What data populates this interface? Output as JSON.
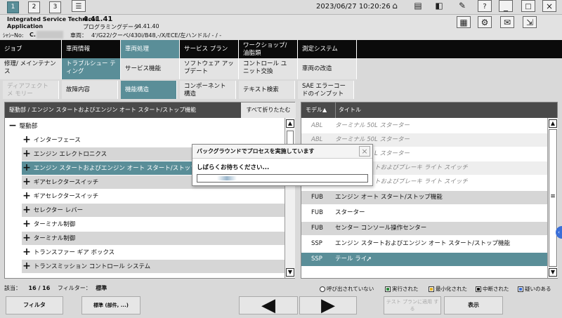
{
  "topbar": {
    "tabs": [
      "1",
      "2",
      "3"
    ],
    "datetime": "2023/06/27 10:20:26"
  },
  "info": {
    "app_line1": "Integrated Service Technical",
    "app_line2": "Application",
    "version": "4.41.41",
    "prog_label": "プログラミングデータ",
    "prog_version": "4.41.40",
    "vin_label": "ｼｬｼｰNo:",
    "vin_value": "C.",
    "vehicle_label": "車両：",
    "vehicle_value": "4'/G22/クーペ/430i/B48,-/X/ECE/左ハンドル/ - / -"
  },
  "menu1": [
    "ジョブ",
    "車両情報",
    "車両処理",
    "サービス プラン",
    "ワークショップ/ 油脂類",
    "測定システム"
  ],
  "menu2": [
    "修理/ メインテナンス",
    "トラブルシュー ティング",
    "サービス機能",
    "ソフトウェア アッ プデート",
    "コントロール ユ ニット交換",
    "車両の改造"
  ],
  "menu3": [
    "ディアフェクト メ モリー",
    "故障内容",
    "機能構造",
    "コンポーネント 構造",
    "テキスト検索",
    "SAE エラーコー ドのインプット"
  ],
  "left_panel": {
    "header": "駆動部 / エンジン スタートおよびエンジン オート スタート/ストップ機能",
    "collapse_all": "すべて折りたたむ",
    "root": "駆動部",
    "items": [
      "インターフェース",
      "エンジン エレクトロニクス",
      "エンジン スタートおよびエンジン オート スタート/ストップ",
      "ギアセレクタースイッチ",
      "ギアセレクタースイッチ",
      "セレクター レバー",
      "ターミナル制御",
      "ターミナル制御",
      "トランスファー ギア ボックス",
      "トランスミッション コントロール システム"
    ]
  },
  "right_panel": {
    "col_model": "モデル▲",
    "col_title": "タイトル",
    "rows": [
      {
        "model": "ABL",
        "title": "ターミナル 50L スターター"
      },
      {
        "model": "ABL",
        "title": "ターミナル 50L スターター"
      },
      {
        "model": "",
        "title": "L スターター"
      },
      {
        "model": "",
        "title": "トおよびブレーキ ライト スイッチ"
      },
      {
        "model": "",
        "title": "トおよびブレーキ ライト スイッチ"
      },
      {
        "model": "FUB",
        "title": "エンジン オート スタート/ストップ機能"
      },
      {
        "model": "FUB",
        "title": "スターター"
      },
      {
        "model": "FUB",
        "title": "センター コンソール操作センター"
      },
      {
        "model": "SSP",
        "title": "エンジン スタートおよびエンジン オート スタート/ストップ機能"
      },
      {
        "model": "SSP",
        "title": "テール ライ"
      }
    ]
  },
  "dialog": {
    "title": "バックグラウンドでプロセスを実施しています",
    "message": "しばらくお待ちください..."
  },
  "status": {
    "count_label": "該当：",
    "count": "16 / 16",
    "filter_label": "フィルター：",
    "filter_value": "標準"
  },
  "legend": [
    "呼び出されていない",
    "実行された",
    "最小化された",
    "中断された",
    "疑いのある"
  ],
  "legend_colors": [
    "#ffffff",
    "#2e8b3e",
    "#e0b020",
    "#111111",
    "#3a6fd8"
  ],
  "buttons": {
    "filter": "フィルタ",
    "standard": "標準 (部件, ...)",
    "apply": "テスト プランに適用 する",
    "display": "表示"
  }
}
